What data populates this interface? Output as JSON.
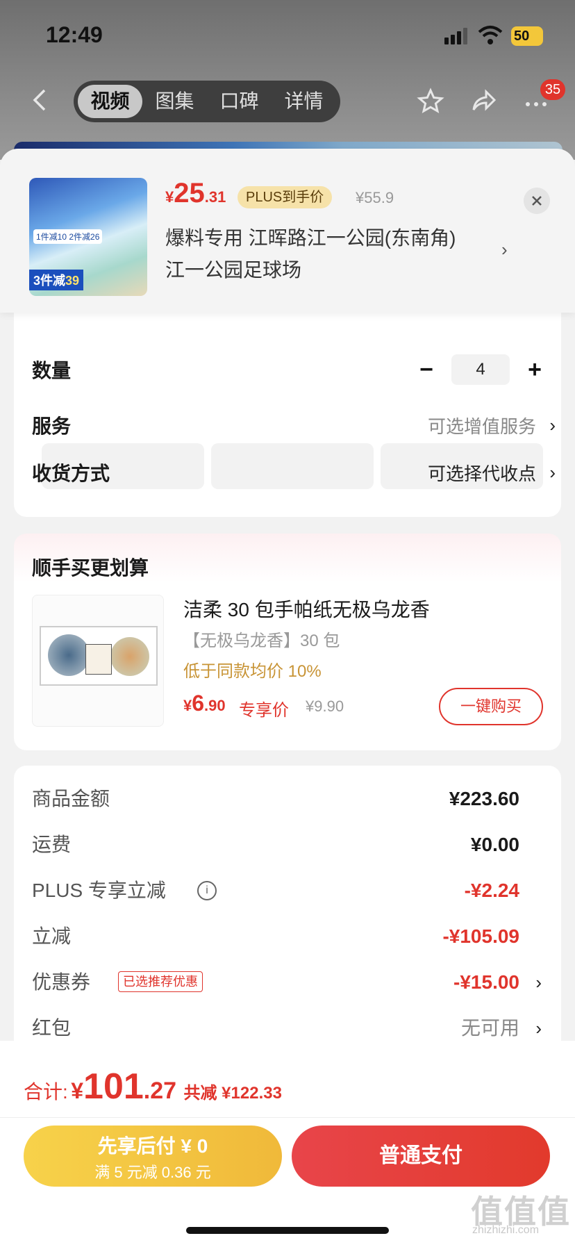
{
  "status_bar": {
    "time": "12:49",
    "battery": "50"
  },
  "nav": {
    "tabs": [
      {
        "label": "视频",
        "active": true
      },
      {
        "label": "图集",
        "active": false
      },
      {
        "label": "口碑",
        "active": false
      },
      {
        "label": "详情",
        "active": false
      }
    ],
    "more_badge": "35",
    "icons": [
      "back-icon",
      "star-icon",
      "share-icon",
      "more-icon"
    ]
  },
  "product": {
    "price_currency": "¥",
    "price_int": "25",
    "price_dec": ".31",
    "plus_tag": "PLUS到手价",
    "original_price": "¥55.9",
    "address_line1": "爆料专用  江晖路江一公园(东南角)",
    "address_line2": "江一公园足球场",
    "thumb_text_promo": "1件减10 2件减26",
    "thumb_text_deal": "3件减",
    "thumb_text_deal_num": "39"
  },
  "order": {
    "quantity_label": "数量",
    "quantity_value": "4",
    "quantity_minus": "−",
    "quantity_plus": "+",
    "service_label": "服务",
    "service_value": "可选增值服务",
    "delivery_label": "收货方式",
    "delivery_value": "可选择代收点"
  },
  "addon": {
    "title": "顺手买更划算",
    "name": "洁柔 30 包手帕纸无极乌龙香",
    "spec": "【无极乌龙香】30 包",
    "note": "低于同款均价 10%",
    "price_currency": "¥",
    "price_int": "6",
    "price_dec": ".90",
    "price_label": "专享价",
    "original_price": "¥9.90",
    "buy_button": "一键购买"
  },
  "summary": {
    "rows": [
      {
        "label": "商品金额",
        "value": "¥223.60"
      },
      {
        "label": "运费",
        "value": "¥0.00"
      },
      {
        "label": "PLUS 专享立减",
        "value": "-¥2.24"
      },
      {
        "label": "立减",
        "value": "-¥105.09"
      },
      {
        "label": "优惠券",
        "value": "-¥15.00",
        "tag": "已选推荐优惠"
      },
      {
        "label": "红包",
        "value": "无可用"
      }
    ]
  },
  "footer": {
    "total_label": "合计:",
    "total_currency": "¥",
    "total_int": "101",
    "total_dec": ".27",
    "total_save": "共减 ¥122.33",
    "pay_later_line1": "先享后付 ¥ 0",
    "pay_later_line2": "满 5 元减 0.36 元",
    "pay_normal": "普通支付"
  },
  "watermark": {
    "main": "值值值",
    "sub": "zhizhizhi.com"
  },
  "colors": {
    "accent_red": "#e0342c",
    "gold": "#f0b93a",
    "plus_tag_bg": "#f6e2a9"
  }
}
